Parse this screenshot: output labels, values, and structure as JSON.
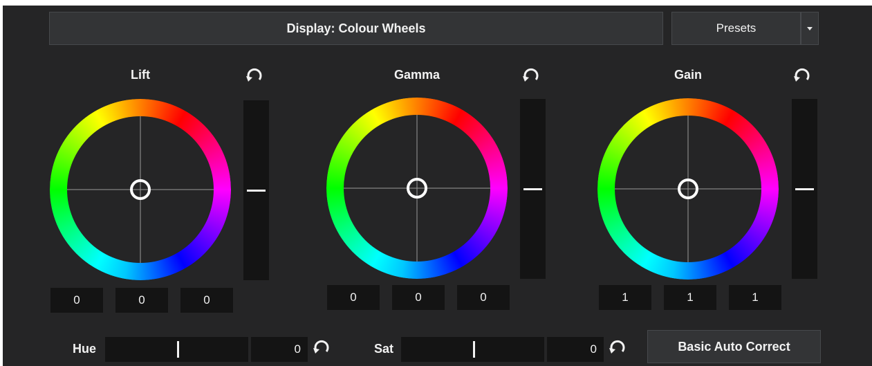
{
  "header": {
    "display_label": "Display: Colour Wheels",
    "presets_label": "Presets"
  },
  "wheels": [
    {
      "title": "Lift",
      "values": [
        "0",
        "0",
        "0"
      ],
      "level": 0.5
    },
    {
      "title": "Gamma",
      "values": [
        "0",
        "0",
        "0"
      ],
      "level": 0.5
    },
    {
      "title": "Gain",
      "values": [
        "1",
        "1",
        "1"
      ],
      "level": 0.5
    }
  ],
  "bottom": {
    "hue_label": "Hue",
    "hue_value": "0",
    "sat_label": "Sat",
    "sat_value": "0",
    "auto_correct_label": "Basic Auto Correct"
  },
  "icons": {
    "reset": "reset-icon",
    "dropdown": "chevron-down-icon"
  },
  "colors": {
    "panel_bg": "#252526",
    "button_bg": "#333436",
    "field_bg": "#141414",
    "text": "#f2f2f2"
  }
}
